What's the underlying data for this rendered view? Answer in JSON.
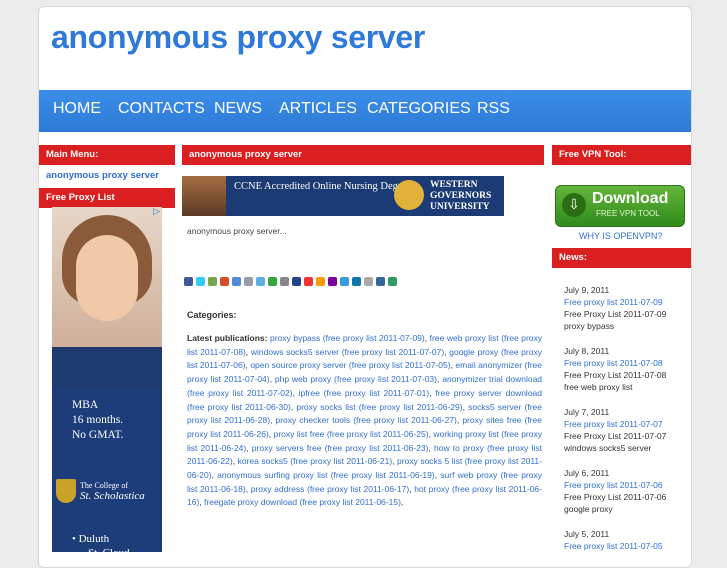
{
  "site": {
    "title": "anonymous proxy server"
  },
  "nav": {
    "items": [
      "HOME",
      "CONTACTS",
      "NEWS",
      "ARTICLES",
      "CATEGORIES",
      "RSS"
    ]
  },
  "left": {
    "main_menu_title": "Main Menu:",
    "main_menu_link": "anonymous proxy server",
    "free_proxy_title": "Free Proxy List",
    "ad": {
      "lines": [
        "MBA",
        "16 months.",
        "No GMAT."
      ],
      "college_line1": "The College of",
      "college_line2": "St. Scholastica",
      "bullet_1": "• Duluth",
      "bullet_2": "St. Cloud"
    }
  },
  "main": {
    "header": "anonymous proxy server",
    "banner": {
      "text": "CCNE Accredited Online Nursing Degrees.",
      "uni_line1": "WESTERN",
      "uni_line2": "GOVERNORS",
      "uni_line3": "UNIVERSITY"
    },
    "excerpt": "anonymous proxy server...",
    "categories_label": "Categories:",
    "latest_label": "Latest publications:",
    "publications": [
      "proxy bypass (free proxy list 2011-07-09)",
      "free web proxy list (free proxy list 2011-07-08)",
      "windows socks5 server (free proxy list 2011-07-07)",
      "google proxy (free proxy list 2011-07-06)",
      "open source proxy server (free proxy list 2011-07-05)",
      "email anonymizer (free proxy list 2011-07-04)",
      "php web proxy (free proxy list 2011-07-03)",
      "anonymizer trial download (free proxy list 2011-07-02)",
      "ipfree (free proxy list 2011-07-01)",
      "free proxy server download (free proxy list 2011-06-30)",
      "proxy socks list (free proxy list 2011-06-29)",
      "socks5 server (free proxy list 2011-06-28)",
      "proxy checker tools (free proxy list 2011-06-27)",
      "proxy sites free (free proxy list 2011-06-26)",
      "proxy list free (free proxy list 2011-06-25)",
      "working proxy list (free proxy list 2011-06-24)",
      "proxy servers free (free proxy list 2011-06-23)",
      "how to proxy (free proxy list 2011-06-22)",
      "korea socks5 (free proxy list 2011-06-21)",
      "proxy socks 5 list (free proxy list 2011-06-20)",
      "anonymous surfing proxy list (free proxy list 2011-06-19)",
      "surf web proxy (free proxy list 2011-06-18)",
      "proxy address (free proxy list 2011-06-17)",
      "hot proxy (free proxy list 2011-06-16)",
      "freegate proxy download (free proxy list 2011-06-15)"
    ]
  },
  "right": {
    "vpn_title": "Free VPN Tool:",
    "download_main": "Download",
    "download_sub": "FREE VPN TOOL",
    "why_link": "WHY IS OPENVPN?",
    "news_title": "News:",
    "news": [
      {
        "date": "July 9, 2011",
        "link": "Free proxy list 2011-07-09",
        "line": "Free Proxy List 2011-07-09",
        "topic": "proxy bypass"
      },
      {
        "date": "July 8, 2011",
        "link": "Free proxy list 2011-07-08",
        "line": "Free Proxy List 2011-07-08",
        "topic": "free web proxy list"
      },
      {
        "date": "July 7, 2011",
        "link": "Free proxy list 2011-07-07",
        "line": "Free Proxy List 2011-07-07",
        "topic": "windows socks5 server"
      },
      {
        "date": "July 6, 2011",
        "link": "Free proxy list 2011-07-06",
        "line": "Free Proxy List 2011-07-06",
        "topic": "google proxy"
      },
      {
        "date": "July 5, 2011",
        "link": "Free proxy list 2011-07-05",
        "line": "",
        "topic": ""
      }
    ]
  },
  "colors": {
    "accent": "#2f7ad8",
    "nav": "#3b8ee9",
    "bar": "#d91f1f",
    "link": "#2f6fd0"
  }
}
